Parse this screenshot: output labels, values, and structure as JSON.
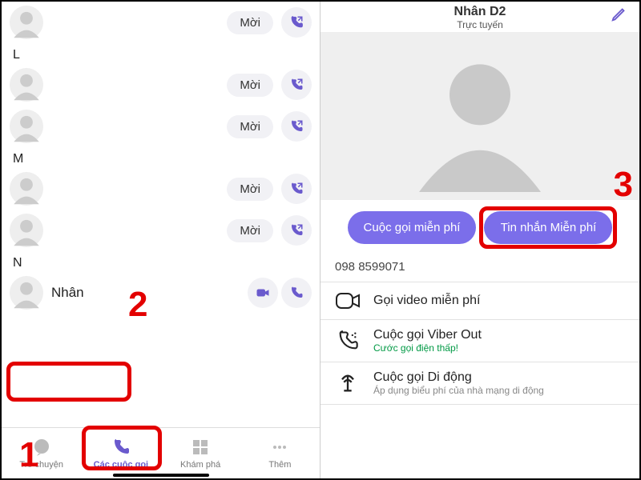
{
  "left": {
    "invite_label": "Mời",
    "groups": [
      {
        "letter": "",
        "rows": [
          {
            "type": "invite"
          }
        ]
      },
      {
        "letter": "L",
        "rows": [
          {
            "type": "invite"
          },
          {
            "type": "invite"
          }
        ]
      },
      {
        "letter": "M",
        "rows": [
          {
            "type": "invite"
          },
          {
            "type": "invite"
          }
        ]
      },
      {
        "letter": "N",
        "rows": [
          {
            "type": "contact",
            "name": "Nhân"
          }
        ]
      }
    ],
    "tabs": {
      "chat": "Trò chuyện",
      "calls": "Các cuộc gọi",
      "explore": "Khám phá",
      "more": "Thêm"
    }
  },
  "right": {
    "title": "Nhân D2",
    "subtitle": "Trực tuyến",
    "btn_call": "Cuộc gọi miễn phí",
    "btn_msg": "Tin nhắn Miễn phí",
    "phone": "098 8599071",
    "items": [
      {
        "title": "Gọi video miễn phí",
        "sub": "",
        "icon": "video"
      },
      {
        "title": "Cuộc gọi Viber Out",
        "sub": "Cước gọi điện thấp!",
        "icon": "viberout",
        "subclass": ""
      },
      {
        "title": "Cuộc gọi Di động",
        "sub": "Áp dụng biểu phí của nhà mạng di động",
        "icon": "antenna",
        "subclass": "grey"
      }
    ]
  },
  "annotations": {
    "n1": "1",
    "n2": "2",
    "n3": "3"
  }
}
